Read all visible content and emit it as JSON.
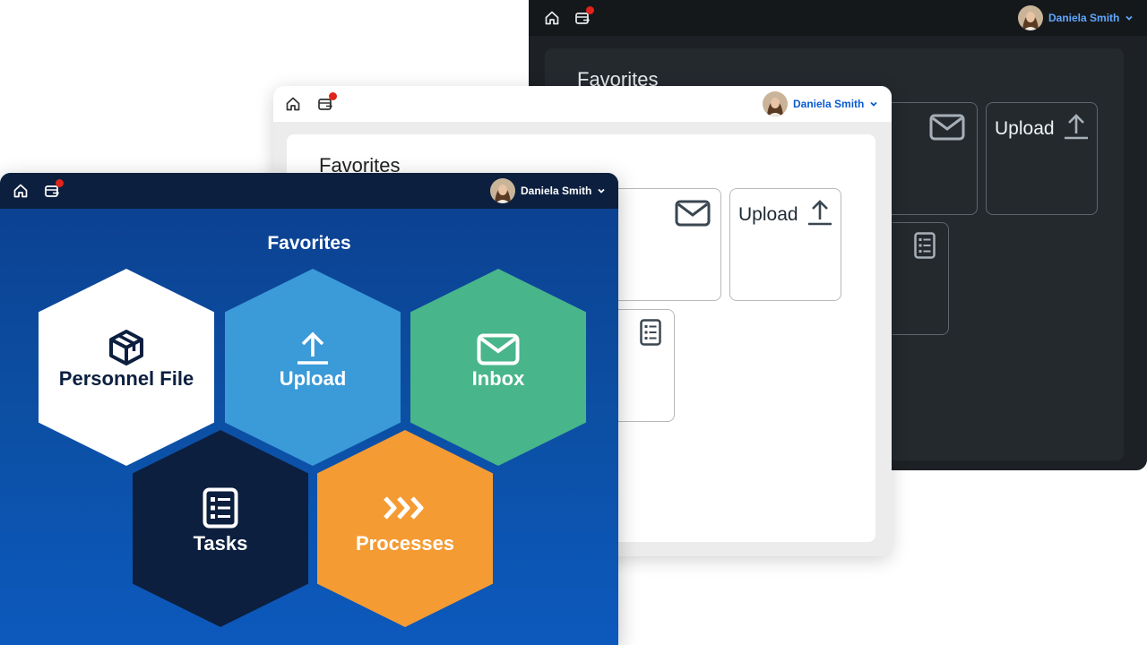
{
  "user": {
    "name": "Daniela Smith"
  },
  "colors": {
    "notification": "#e0241b",
    "personnel": "#ffffff",
    "upload": "#3b9ad8",
    "inbox": "#48b58b",
    "tasks": "#0c1f3f",
    "processes": "#f49b33",
    "dark_accent": "#5fa7ff",
    "light_accent": "#0a5bd0"
  },
  "icons": {
    "home": "home-icon",
    "calendar": "calendar-notification-icon",
    "chevron": "chevron-down-icon",
    "upload": "upload-arrow-icon",
    "inbox": "envelope-icon",
    "tasks": "checklist-icon",
    "processes": "triple-chevron-icon",
    "personnel": "personnel-box-icon"
  },
  "dark_window": {
    "favorites_title": "Favorites",
    "tiles": [
      {
        "label": "Upload"
      }
    ]
  },
  "light_window": {
    "favorites_title": "Favorites",
    "tiles": [
      {
        "label": "Upload"
      }
    ]
  },
  "blue_window": {
    "favorites_title": "Favorites",
    "tiles": [
      {
        "label": "Personnel File"
      },
      {
        "label": "Upload"
      },
      {
        "label": "Inbox"
      },
      {
        "label": "Tasks"
      },
      {
        "label": "Processes"
      }
    ]
  }
}
